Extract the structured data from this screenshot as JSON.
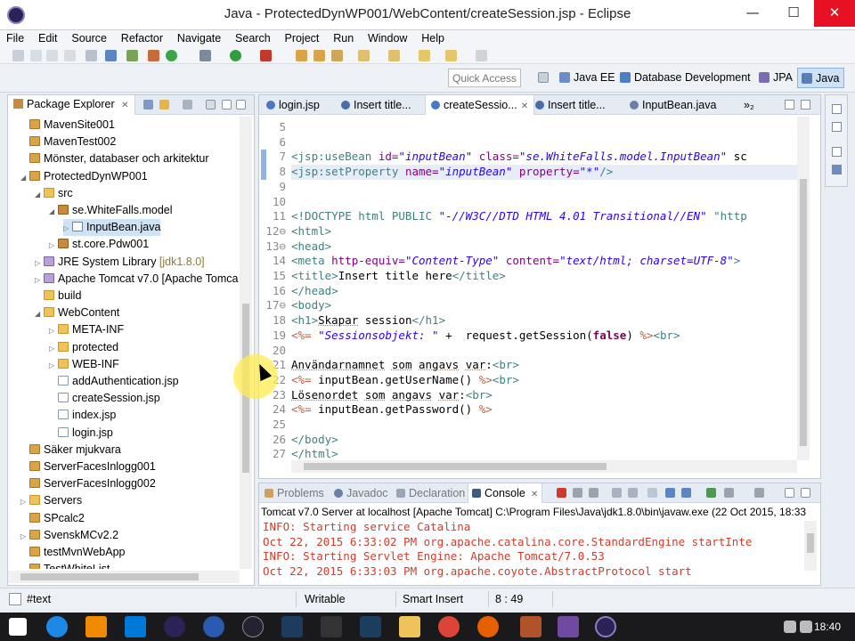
{
  "window": {
    "title": "Java - ProtectedDynWP001/WebContent/createSession.jsp - Eclipse",
    "minimize": "—",
    "maximize": "☐",
    "close": "✕"
  },
  "menu": [
    "File",
    "Edit",
    "Source",
    "Refactor",
    "Navigate",
    "Search",
    "Project",
    "Run",
    "Window",
    "Help"
  ],
  "quick_access": {
    "placeholder": "Quick Access"
  },
  "perspectives": [
    "Java EE",
    "Database Development",
    "JPA",
    "Java"
  ],
  "package_explorer": {
    "title": "Package Explorer",
    "close": "✕",
    "tree": [
      {
        "label": "MavenSite001",
        "indent": 0,
        "icon": "proj",
        "twisty": ""
      },
      {
        "label": "MavenTest002",
        "indent": 0,
        "icon": "proj",
        "twisty": ""
      },
      {
        "label": "Mönster, databaser och arkitektur",
        "indent": 0,
        "icon": "proj",
        "twisty": ""
      },
      {
        "label": "ProtectedDynWP001",
        "indent": 0,
        "icon": "proj",
        "twisty": "◢"
      },
      {
        "label": "src",
        "indent": 1,
        "icon": "folder",
        "twisty": "◢"
      },
      {
        "label": "se.WhiteFalls.model",
        "indent": 2,
        "icon": "pkg",
        "twisty": "◢"
      },
      {
        "label": "InputBean.java",
        "indent": 3,
        "icon": "java",
        "twisty": "▷",
        "selected": true
      },
      {
        "label": "st.core.Pdw001",
        "indent": 2,
        "icon": "pkg",
        "twisty": "▷"
      },
      {
        "label": "JRE System Library",
        "deco": "[jdk1.8.0]",
        "indent": 1,
        "icon": "lib",
        "twisty": "▷"
      },
      {
        "label": "Apache Tomcat v7.0 [Apache Tomca",
        "indent": 1,
        "icon": "lib",
        "twisty": "▷"
      },
      {
        "label": "build",
        "indent": 1,
        "icon": "folder",
        "twisty": ""
      },
      {
        "label": "WebContent",
        "indent": 1,
        "icon": "folder",
        "twisty": "◢"
      },
      {
        "label": "META-INF",
        "indent": 2,
        "icon": "folder",
        "twisty": "▷"
      },
      {
        "label": "protected",
        "indent": 2,
        "icon": "folder",
        "twisty": "▷"
      },
      {
        "label": "WEB-INF",
        "indent": 2,
        "icon": "folder",
        "twisty": "▷"
      },
      {
        "label": "addAuthentication.jsp",
        "indent": 2,
        "icon": "file",
        "twisty": ""
      },
      {
        "label": "createSession.jsp",
        "indent": 2,
        "icon": "file",
        "twisty": ""
      },
      {
        "label": "index.jsp",
        "indent": 2,
        "icon": "file",
        "twisty": ""
      },
      {
        "label": "login.jsp",
        "indent": 2,
        "icon": "file",
        "twisty": ""
      },
      {
        "label": "Säker mjukvara",
        "indent": 0,
        "icon": "proj",
        "twisty": ""
      },
      {
        "label": "ServerFacesInlogg001",
        "indent": 0,
        "icon": "proj",
        "twisty": ""
      },
      {
        "label": "ServerFacesInlogg002",
        "indent": 0,
        "icon": "proj",
        "twisty": ""
      },
      {
        "label": "Servers",
        "indent": 0,
        "icon": "folder",
        "twisty": "▷"
      },
      {
        "label": "SPcalc2",
        "indent": 0,
        "icon": "proj",
        "twisty": ""
      },
      {
        "label": "SvenskMCv2.2",
        "indent": 0,
        "icon": "proj",
        "twisty": "▷"
      },
      {
        "label": "testMvnWebApp",
        "indent": 0,
        "icon": "proj",
        "twisty": ""
      },
      {
        "label": "TestWhiteList",
        "indent": 0,
        "icon": "proj",
        "twisty": ""
      }
    ]
  },
  "editor": {
    "tabs": [
      {
        "label": "login.jsp",
        "color": "#4a78c2"
      },
      {
        "label": "Insert title...",
        "color": "#4a6da8"
      },
      {
        "label": "createSessio...",
        "color": "#4a78c2",
        "active": true,
        "close": "✕"
      },
      {
        "label": "Insert title...",
        "color": "#4a6da8"
      },
      {
        "label": "InputBean.java",
        "color": "#6b7fa8"
      }
    ],
    "overflow": "»₂",
    "lines": [
      {
        "n": "5",
        "t": []
      },
      {
        "n": "6",
        "t": []
      },
      {
        "n": "7",
        "t": [
          [
            "tag",
            "<jsp:useBean "
          ],
          [
            "attr",
            "id="
          ],
          [
            "str",
            "\"inputBean\""
          ],
          [
            "txt",
            " "
          ],
          [
            "attr",
            "class="
          ],
          [
            "str",
            "\"se.WhiteFalls.model.InputBean\""
          ],
          [
            "txt",
            " sc"
          ]
        ]
      },
      {
        "n": "8",
        "t": [
          [
            "tag",
            "<jsp:setProperty "
          ],
          [
            "attr",
            "name="
          ],
          [
            "str",
            "\"inputBean\""
          ],
          [
            "txt",
            " "
          ],
          [
            "attr",
            "property="
          ],
          [
            "str",
            "\"*\""
          ],
          [
            "tag",
            "/>"
          ]
        ],
        "hl": true
      },
      {
        "n": "9",
        "t": []
      },
      {
        "n": "10",
        "t": []
      },
      {
        "n": "11",
        "t": [
          [
            "doc",
            "<!DOCTYPE html PUBLIC "
          ],
          [
            "str2",
            "\"-//W3C//DTD HTML 4.01 Transitional//EN\""
          ],
          [
            "doc",
            " \"http"
          ]
        ]
      },
      {
        "n": "12⊖",
        "t": [
          [
            "tag",
            "<html>"
          ]
        ]
      },
      {
        "n": "13⊖",
        "t": [
          [
            "tag",
            "<head>"
          ]
        ]
      },
      {
        "n": "14",
        "t": [
          [
            "tag",
            "<meta "
          ],
          [
            "attr",
            "http-equiv="
          ],
          [
            "str",
            "\"Content-Type\""
          ],
          [
            "txt",
            " "
          ],
          [
            "attr",
            "content="
          ],
          [
            "str",
            "\"text/html; charset=UTF-8\""
          ],
          [
            "tag",
            ">"
          ]
        ]
      },
      {
        "n": "15",
        "t": [
          [
            "tag",
            "<title>"
          ],
          [
            "txt",
            "Insert title here"
          ],
          [
            "tag",
            "</title>"
          ]
        ]
      },
      {
        "n": "16",
        "t": [
          [
            "tag",
            "</head>"
          ]
        ]
      },
      {
        "n": "17⊖",
        "t": [
          [
            "tag",
            "<body>"
          ]
        ]
      },
      {
        "n": "18",
        "t": [
          [
            "tag",
            "<h1>"
          ],
          [
            "und",
            "Skapar"
          ],
          [
            "txt",
            " session"
          ],
          [
            "tag",
            "</h1>"
          ]
        ]
      },
      {
        "n": "19",
        "t": [
          [
            "jsp",
            "<%= "
          ],
          [
            "str",
            "\"Sessionsobjekt: \""
          ],
          [
            "txt",
            " +  request.getSession("
          ],
          [
            "kw",
            "false"
          ],
          [
            "txt",
            ") "
          ],
          [
            "jsp",
            "%>"
          ],
          [
            "tag",
            "<br>"
          ]
        ]
      },
      {
        "n": "20",
        "t": []
      },
      {
        "n": "21",
        "t": [
          [
            "und",
            "Användarnamnet"
          ],
          [
            "txt",
            " "
          ],
          [
            "und",
            "som"
          ],
          [
            "txt",
            " "
          ],
          [
            "und",
            "angavs"
          ],
          [
            "txt",
            " "
          ],
          [
            "und",
            "var"
          ],
          [
            "txt",
            ":"
          ],
          [
            "tag",
            "<br>"
          ]
        ]
      },
      {
        "n": "22",
        "t": [
          [
            "jsp",
            "<%= "
          ],
          [
            "txt",
            "inputBean.getUserName() "
          ],
          [
            "jsp",
            "%>"
          ],
          [
            "tag",
            "<br>"
          ]
        ]
      },
      {
        "n": "23",
        "t": [
          [
            "und",
            "Lösenordet"
          ],
          [
            "txt",
            " "
          ],
          [
            "und",
            "som"
          ],
          [
            "txt",
            " "
          ],
          [
            "und",
            "angavs"
          ],
          [
            "txt",
            " "
          ],
          [
            "und",
            "var"
          ],
          [
            "txt",
            ":"
          ],
          [
            "tag",
            "<br>"
          ]
        ]
      },
      {
        "n": "24",
        "t": [
          [
            "jsp",
            "<%= "
          ],
          [
            "txt",
            "inputBean.getPassword() "
          ],
          [
            "jsp",
            "%>"
          ]
        ]
      },
      {
        "n": "25",
        "t": []
      },
      {
        "n": "26",
        "t": [
          [
            "tag",
            "</body>"
          ]
        ]
      },
      {
        "n": "27",
        "t": [
          [
            "tag",
            "</html>"
          ]
        ]
      }
    ]
  },
  "console": {
    "tabs": [
      "Problems",
      "Javadoc",
      "Declaration",
      "Console"
    ],
    "active_tab": "Console",
    "close": "✕",
    "header": "Tomcat v7.0 Server at localhost [Apache Tomcat] C:\\Program Files\\Java\\jdk1.8.0\\bin\\javaw.exe (22 Oct 2015, 18:33",
    "lines": [
      "INFO: Starting service Catalina",
      "Oct 22, 2015 6:33:02 PM org.apache.catalina.core.StandardEngine startInte",
      "INFO: Starting Servlet Engine: Apache Tomcat/7.0.53",
      "Oct 22, 2015 6:33:03 PM org.apache.coyote.AbstractProtocol start"
    ]
  },
  "status": {
    "selection": "#text",
    "writable": "Writable",
    "insert_mode": "Smart Insert",
    "position": "8 : 49"
  },
  "taskbar": {
    "clock": "18:40",
    "colors": {
      "start": "#ffffff",
      "ie": "#1e88e5",
      "vlc": "#f08a00",
      "mail": "#0078d7",
      "eclipse": "#2c2255"
    }
  }
}
